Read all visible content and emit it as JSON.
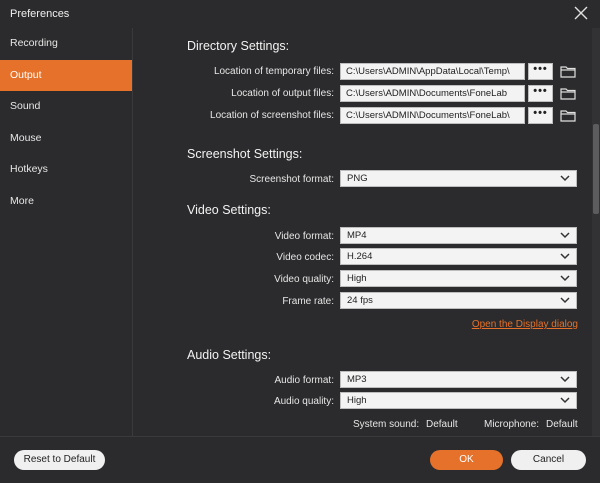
{
  "window": {
    "title": "Preferences"
  },
  "sidebar": {
    "items": [
      {
        "label": "Recording",
        "active": false
      },
      {
        "label": "Output",
        "active": true
      },
      {
        "label": "Sound",
        "active": false
      },
      {
        "label": "Mouse",
        "active": false
      },
      {
        "label": "Hotkeys",
        "active": false
      },
      {
        "label": "More",
        "active": false
      }
    ]
  },
  "directory": {
    "title": "Directory Settings:",
    "temp_label": "Location of temporary files:",
    "temp_value": "C:\\Users\\ADMIN\\AppData\\Local\\Temp\\",
    "output_label": "Location of output files:",
    "output_value": "C:\\Users\\ADMIN\\Documents\\FoneLab",
    "screenshot_label": "Location of screenshot files:",
    "screenshot_value": "C:\\Users\\ADMIN\\Documents\\FoneLab\\",
    "browse_label": "•••"
  },
  "screenshot": {
    "title": "Screenshot Settings:",
    "format_label": "Screenshot format:",
    "format_value": "PNG"
  },
  "video": {
    "title": "Video Settings:",
    "format_label": "Video format:",
    "format_value": "MP4",
    "codec_label": "Video codec:",
    "codec_value": "H.264",
    "quality_label": "Video quality:",
    "quality_value": "High",
    "framerate_label": "Frame rate:",
    "framerate_value": "24 fps",
    "display_link": "Open the Display dialog"
  },
  "audio": {
    "title": "Audio Settings:",
    "format_label": "Audio format:",
    "format_value": "MP3",
    "quality_label": "Audio quality:",
    "quality_value": "High",
    "system_sound_label": "System sound:",
    "system_sound_value": "Default",
    "microphone_label": "Microphone:",
    "microphone_value": "Default"
  },
  "footer": {
    "reset_label": "Reset to Default",
    "ok_label": "OK",
    "cancel_label": "Cancel"
  },
  "colors": {
    "accent": "#e5712a",
    "background": "#2b2b2d"
  }
}
